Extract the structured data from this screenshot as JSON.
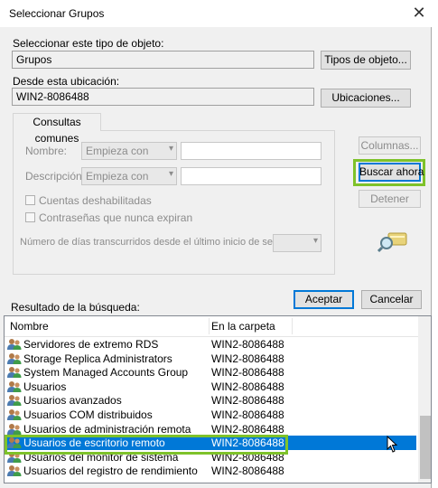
{
  "dialog": {
    "title": "Seleccionar Grupos",
    "close_glyph": "✕"
  },
  "object_type": {
    "label": "Seleccionar este tipo de objeto:",
    "value": "Grupos",
    "button": "Tipos de objeto..."
  },
  "location": {
    "label": "Desde esta ubicación:",
    "value": "WIN2-8086488",
    "button": "Ubicaciones..."
  },
  "common_queries": {
    "tab": "Consultas comunes",
    "name_label": "Nombre:",
    "name_mode": "Empieza con",
    "description_label": "Descripción:",
    "description_mode": "Empieza con",
    "disabled_accounts": "Cuentas deshabilitadas",
    "non_expiring_passwords": "Contraseñas que nunca expiran",
    "days_label": "Número de días transcurridos desde el último inicio de sesión:"
  },
  "side_buttons": {
    "columns": "Columnas...",
    "search_now": "Buscar ahora",
    "stop": "Detener"
  },
  "footer": {
    "ok": "Aceptar",
    "cancel": "Cancelar"
  },
  "results": {
    "label": "Resultado de la búsqueda:",
    "columns": [
      "Nombre",
      "En la carpeta"
    ],
    "rows": [
      {
        "name": "Servidores de extremo RDS",
        "folder": "WIN2-8086488"
      },
      {
        "name": "Storage Replica Administrators",
        "folder": "WIN2-8086488"
      },
      {
        "name": "System Managed Accounts Group",
        "folder": "WIN2-8086488"
      },
      {
        "name": "Usuarios",
        "folder": "WIN2-8086488"
      },
      {
        "name": "Usuarios avanzados",
        "folder": "WIN2-8086488"
      },
      {
        "name": "Usuarios COM distribuidos",
        "folder": "WIN2-8086488"
      },
      {
        "name": "Usuarios de administración remota",
        "folder": "WIN2-8086488"
      },
      {
        "name": "Usuarios de escritorio remoto",
        "folder": "WIN2-8086488",
        "selected": true
      },
      {
        "name": "Usuarios del monitor de sistema",
        "folder": "WIN2-8086488"
      },
      {
        "name": "Usuarios del registro de rendimiento",
        "folder": "WIN2-8086488"
      }
    ]
  },
  "colors": {
    "selection": "#0078d7",
    "highlight_outline": "#7ec22a"
  },
  "icons": {
    "group": "group-icon",
    "search": "search-icon",
    "cursor": "mouse-cursor-icon"
  }
}
